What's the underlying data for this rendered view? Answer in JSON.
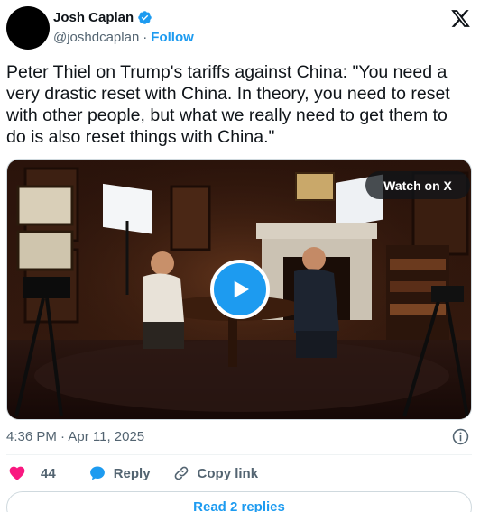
{
  "author": {
    "display_name": "Josh Caplan",
    "handle": "@joshdcaplan",
    "separator": "·",
    "follow_label": "Follow",
    "verified_color": "#1d9bf0"
  },
  "tweet": {
    "text": "Peter Thiel on Trump's tariffs against China: \"You need a very drastic reset with China. In theory, you need to reset with other people, but what we really need to get them to do is also reset things with China.\""
  },
  "media": {
    "type": "video",
    "overlay_label": "Watch on X",
    "play_icon": "play-icon"
  },
  "meta": {
    "timestamp": "4:36 PM · Apr 11, 2025"
  },
  "actions": {
    "like_count": "44",
    "reply_label": "Reply",
    "copy_link_label": "Copy link"
  },
  "footer": {
    "read_replies_label": "Read 2 replies"
  },
  "colors": {
    "accent": "#1d9bf0",
    "like": "#f91880",
    "text": "#0f1419",
    "muted": "#536471"
  }
}
